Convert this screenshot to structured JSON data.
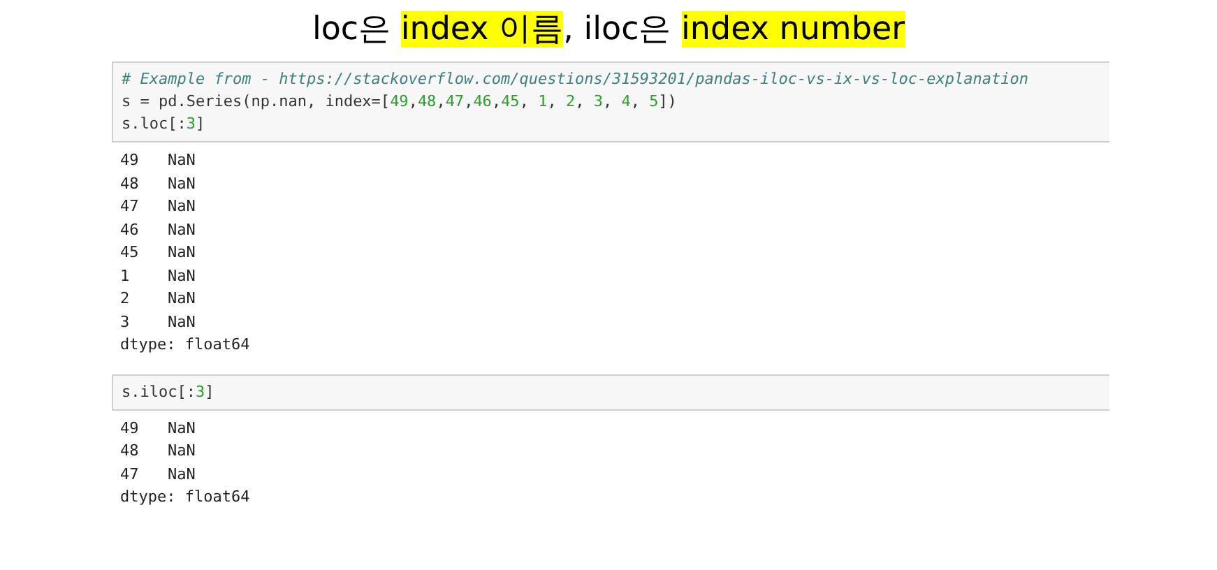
{
  "title": [
    {
      "text": "loc은 ",
      "highlighted": false
    },
    {
      "text": "index 이름",
      "highlighted": true
    },
    {
      "text": ", iloc은 ",
      "highlighted": false
    },
    {
      "text": "index number",
      "highlighted": true
    }
  ],
  "cells": [
    {
      "code": [
        [
          {
            "text": "# Example from - https://stackoverflow.com/questions/31593201/pandas-iloc-vs-ix-vs-loc-explanation",
            "kind": "comment"
          }
        ],
        [
          {
            "text": "s = pd.Series(np.nan, index=[",
            "kind": "plain"
          },
          {
            "text": "49",
            "kind": "number"
          },
          {
            "text": ",",
            "kind": "plain"
          },
          {
            "text": "48",
            "kind": "number"
          },
          {
            "text": ",",
            "kind": "plain"
          },
          {
            "text": "47",
            "kind": "number"
          },
          {
            "text": ",",
            "kind": "plain"
          },
          {
            "text": "46",
            "kind": "number"
          },
          {
            "text": ",",
            "kind": "plain"
          },
          {
            "text": "45",
            "kind": "number"
          },
          {
            "text": ", ",
            "kind": "plain"
          },
          {
            "text": "1",
            "kind": "number"
          },
          {
            "text": ", ",
            "kind": "plain"
          },
          {
            "text": "2",
            "kind": "number"
          },
          {
            "text": ", ",
            "kind": "plain"
          },
          {
            "text": "3",
            "kind": "number"
          },
          {
            "text": ", ",
            "kind": "plain"
          },
          {
            "text": "4",
            "kind": "number"
          },
          {
            "text": ", ",
            "kind": "plain"
          },
          {
            "text": "5",
            "kind": "number"
          },
          {
            "text": "])",
            "kind": "plain"
          }
        ],
        [
          {
            "text": "s.loc[:",
            "kind": "plain"
          },
          {
            "text": "3",
            "kind": "number"
          },
          {
            "text": "]",
            "kind": "plain"
          }
        ]
      ],
      "output": {
        "rows": [
          {
            "index": "49",
            "value": "NaN"
          },
          {
            "index": "48",
            "value": "NaN"
          },
          {
            "index": "47",
            "value": "NaN"
          },
          {
            "index": "46",
            "value": "NaN"
          },
          {
            "index": "45",
            "value": "NaN"
          },
          {
            "index": "1",
            "value": "NaN"
          },
          {
            "index": "2",
            "value": "NaN"
          },
          {
            "index": "3",
            "value": "NaN"
          }
        ],
        "dtype": "dtype: float64"
      }
    },
    {
      "code": [
        [
          {
            "text": "s.iloc[:",
            "kind": "plain"
          },
          {
            "text": "3",
            "kind": "number"
          },
          {
            "text": "]",
            "kind": "plain"
          }
        ]
      ],
      "output": {
        "rows": [
          {
            "index": "49",
            "value": "NaN"
          },
          {
            "index": "48",
            "value": "NaN"
          },
          {
            "index": "47",
            "value": "NaN"
          }
        ],
        "dtype": "dtype: float64"
      }
    }
  ]
}
